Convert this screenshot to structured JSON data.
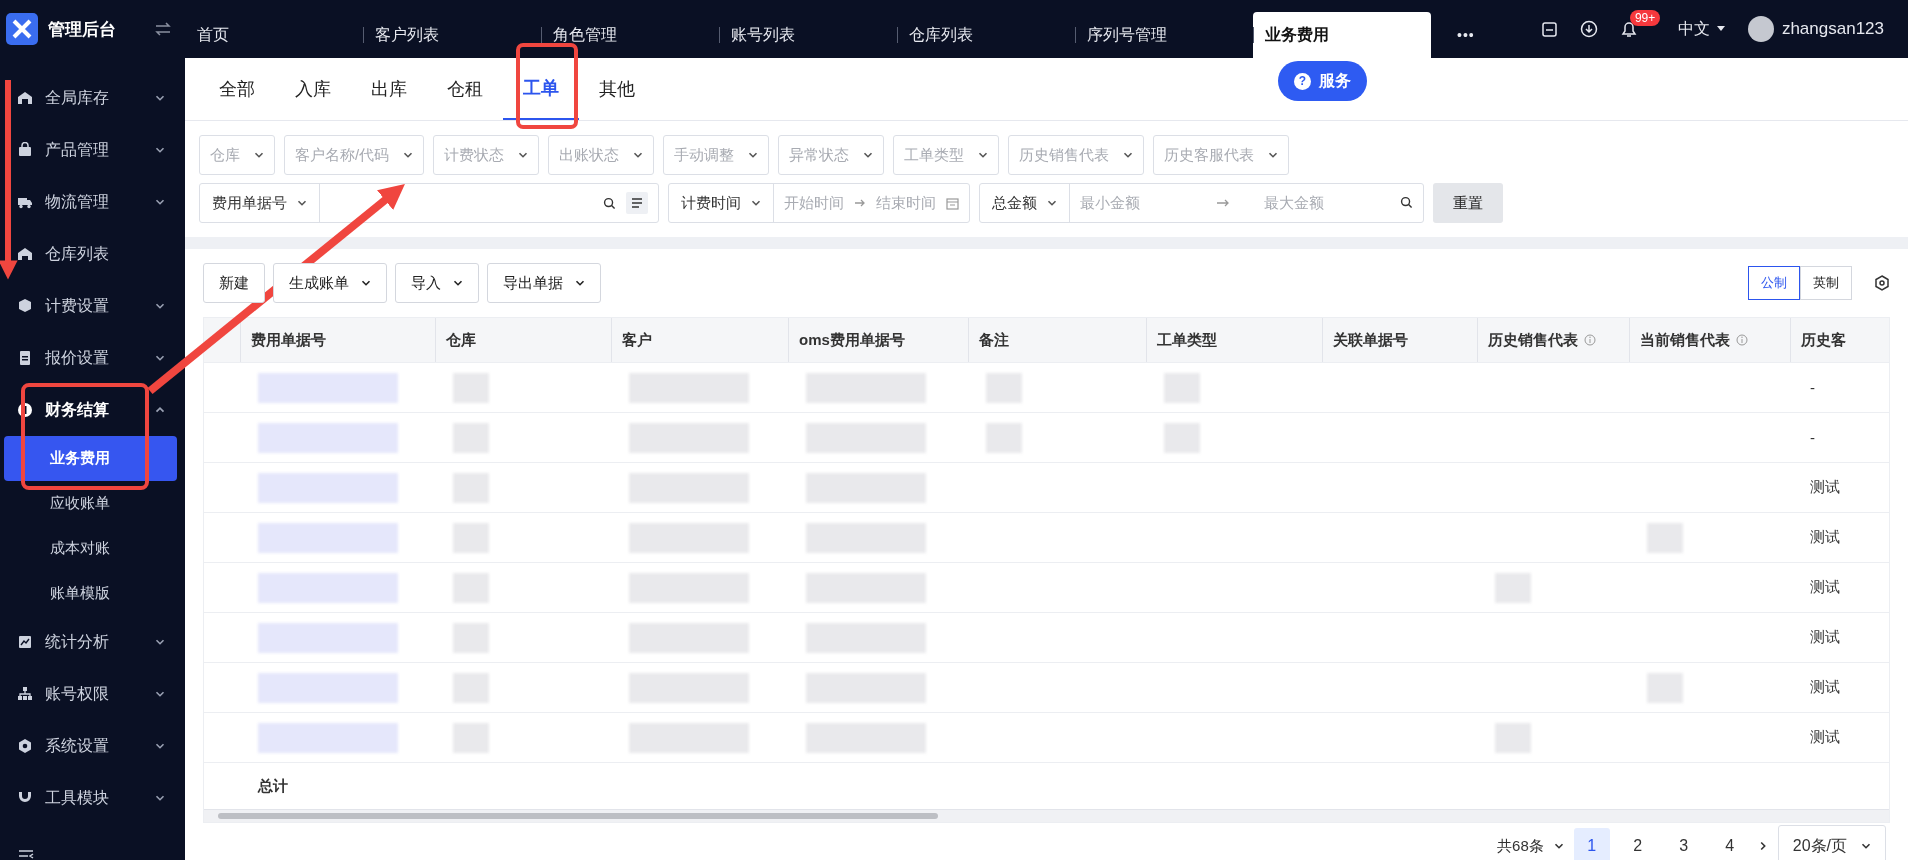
{
  "sidebar": {
    "logo_text": "管理后台",
    "items": [
      {
        "label": "全局库存",
        "kind": "group",
        "expanded": false
      },
      {
        "label": "产品管理",
        "kind": "group",
        "expanded": false
      },
      {
        "label": "物流管理",
        "kind": "group",
        "expanded": false
      },
      {
        "label": "仓库列表",
        "kind": "link"
      },
      {
        "label": "计费设置",
        "kind": "group",
        "expanded": false
      },
      {
        "label": "报价设置",
        "kind": "group",
        "expanded": false
      },
      {
        "label": "财务结算",
        "kind": "group",
        "expanded": true,
        "children": [
          {
            "label": "业务费用",
            "selected": true
          },
          {
            "label": "应收账单",
            "selected": false
          },
          {
            "label": "成本对账",
            "selected": false
          },
          {
            "label": "账单模版",
            "selected": false
          }
        ]
      },
      {
        "label": "统计分析",
        "kind": "group",
        "expanded": false
      },
      {
        "label": "账号权限",
        "kind": "group",
        "expanded": false
      },
      {
        "label": "系统设置",
        "kind": "group",
        "expanded": false
      },
      {
        "label": "工具模块",
        "kind": "group",
        "expanded": false
      }
    ]
  },
  "top_tabs": [
    {
      "label": "首页",
      "selected": false
    },
    {
      "label": "客户列表",
      "selected": false
    },
    {
      "label": "角色管理",
      "selected": false
    },
    {
      "label": "账号列表",
      "selected": false
    },
    {
      "label": "仓库列表",
      "selected": false
    },
    {
      "label": "序列号管理",
      "selected": false
    },
    {
      "label": "业务费用",
      "selected": true
    }
  ],
  "top_bar": {
    "more": "•••",
    "notification_count": "99+",
    "language": "中文",
    "user": "zhangsan123"
  },
  "sub_tabs": [
    {
      "label": "全部",
      "selected": false
    },
    {
      "label": "入库",
      "selected": false
    },
    {
      "label": "出库",
      "selected": false
    },
    {
      "label": "仓租",
      "selected": false
    },
    {
      "label": "工单",
      "selected": true
    },
    {
      "label": "其他",
      "selected": false
    }
  ],
  "service_button": {
    "icon": "?",
    "label": "服务"
  },
  "filters": {
    "selects": [
      {
        "placeholder": "仓库"
      },
      {
        "placeholder": "客户名称/代码"
      },
      {
        "placeholder": "计费状态"
      },
      {
        "placeholder": "出账状态"
      },
      {
        "placeholder": "手动调整"
      },
      {
        "placeholder": "异常状态"
      },
      {
        "placeholder": "工单类型"
      },
      {
        "placeholder": "历史销售代表"
      },
      {
        "placeholder": "历史客服代表"
      }
    ],
    "combos": [
      {
        "kind": "search",
        "select": "费用单据号"
      },
      {
        "kind": "date-range",
        "select": "计费时间",
        "start": "开始时间",
        "end": "结束时间"
      },
      {
        "kind": "number-range",
        "select": "总金额",
        "min": "最小金额",
        "max": "最大金额"
      }
    ],
    "reset": "重置"
  },
  "toolbar": {
    "buttons": [
      {
        "label": "新建",
        "dropdown": false
      },
      {
        "label": "生成账单",
        "dropdown": true
      },
      {
        "label": "导入",
        "dropdown": true
      },
      {
        "label": "导出单据",
        "dropdown": true
      }
    ],
    "units": [
      {
        "label": "公制",
        "selected": true
      },
      {
        "label": "英制",
        "selected": false
      }
    ]
  },
  "table": {
    "columns": [
      {
        "label": "费用单据号",
        "info": false
      },
      {
        "label": "仓库",
        "info": false
      },
      {
        "label": "客户",
        "info": false
      },
      {
        "label": "oms费用单据号",
        "info": false
      },
      {
        "label": "备注",
        "info": false
      },
      {
        "label": "工单类型",
        "info": false
      },
      {
        "label": "关联单据号",
        "info": false
      },
      {
        "label": "历史销售代表",
        "info": true
      },
      {
        "label": "当前销售代表",
        "info": true
      },
      {
        "label": "历史客",
        "info": false
      }
    ],
    "rows": [
      {
        "column_10": "-"
      },
      {
        "column_10": "-"
      },
      {
        "column_10": "测试"
      },
      {
        "column_10": "测试"
      },
      {
        "column_10": "测试"
      },
      {
        "column_10": "测试"
      },
      {
        "column_10": "测试"
      },
      {
        "column_10": "测试"
      }
    ],
    "footer": "总计"
  },
  "pagination": {
    "total": "共68条",
    "pages": [
      {
        "label": "1",
        "selected": true
      },
      {
        "label": "2",
        "selected": false
      },
      {
        "label": "3",
        "selected": false
      },
      {
        "label": "4",
        "selected": false
      }
    ],
    "page_size": "20条/页"
  }
}
